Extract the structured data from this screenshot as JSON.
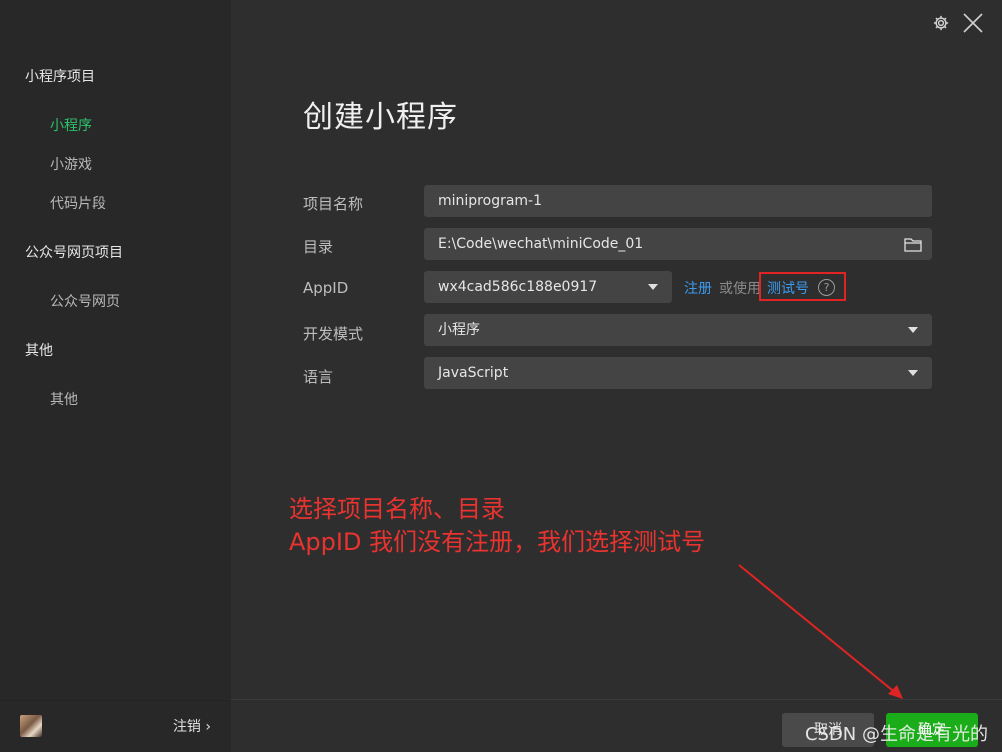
{
  "sidebar": {
    "groups": [
      {
        "label": "小程序项目",
        "items": [
          "小程序",
          "小游戏",
          "代码片段"
        ]
      },
      {
        "label": "公众号网页项目",
        "items": [
          "公众号网页"
        ]
      },
      {
        "label": "其他",
        "items": [
          "其他"
        ]
      }
    ],
    "footer": {
      "logout_label": "注销 ›"
    }
  },
  "header": {
    "settings_icon": "gear-icon",
    "close_icon": "close-icon"
  },
  "main": {
    "title": "创建小程序",
    "fields": {
      "project_name": {
        "label": "项目名称",
        "value": "miniprogram-1"
      },
      "directory": {
        "label": "目录",
        "value": "E:\\Code\\wechat\\miniCode_01"
      },
      "appid": {
        "label": "AppID",
        "value": "wx4cad586c188e0917"
      },
      "dev_mode": {
        "label": "开发模式",
        "value": "小程序"
      },
      "language": {
        "label": "语言",
        "value": "JavaScript"
      }
    },
    "appid_links": {
      "register": "注册",
      "or_use": "或使用",
      "test_account": "测试号",
      "help": "?"
    }
  },
  "annotation": {
    "line1": "选择项目名称、目录",
    "line2": "AppID 我们没有注册，我们选择测试号"
  },
  "footer": {
    "cancel_label": "取消",
    "ok_label": "确定"
  },
  "watermark": "CSDN @生命是有光的",
  "colors": {
    "accent_green": "#2cc36b",
    "link_blue": "#3a9bf0",
    "annotation_red": "#e8332f"
  }
}
